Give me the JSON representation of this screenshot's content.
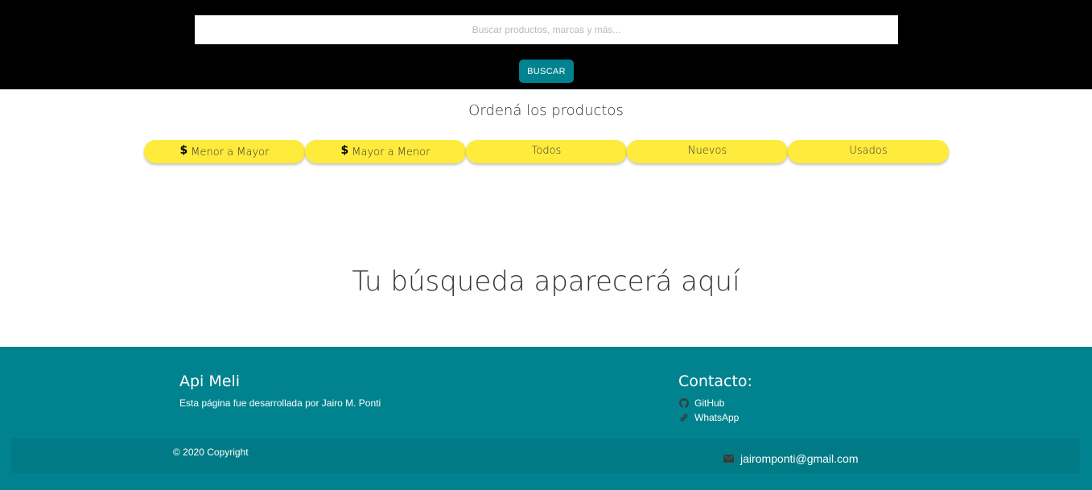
{
  "header": {
    "search_placeholder": "Buscar productos, marcas y más...",
    "search_button_label": "BUSCAR"
  },
  "sort": {
    "title": "Ordená los productos",
    "buttons": [
      {
        "label": "Menor a Mayor",
        "icon": "dollar-icon"
      },
      {
        "label": "Mayor a Menor",
        "icon": "dollar-icon"
      },
      {
        "label": "Todos"
      },
      {
        "label": "Nuevos"
      },
      {
        "label": "Usados"
      }
    ]
  },
  "main": {
    "placeholder": "Tu búsqueda aparecerá aquí"
  },
  "footer": {
    "brand": "Api Meli",
    "description": "Esta página fue desarrollada por Jairo M. Ponti",
    "contact_title": "Contacto:",
    "links": [
      {
        "label": "GitHub",
        "icon": "github-icon"
      },
      {
        "label": "WhatsApp",
        "icon": "link-icon"
      }
    ],
    "copyright": "© 2020 Copyright",
    "email": "jairomponti@gmail.com",
    "email_icon": "mail-icon"
  },
  "colors": {
    "header_bg": "#000000",
    "accent": "#00838f",
    "sort_button": "#ffeb3b"
  }
}
